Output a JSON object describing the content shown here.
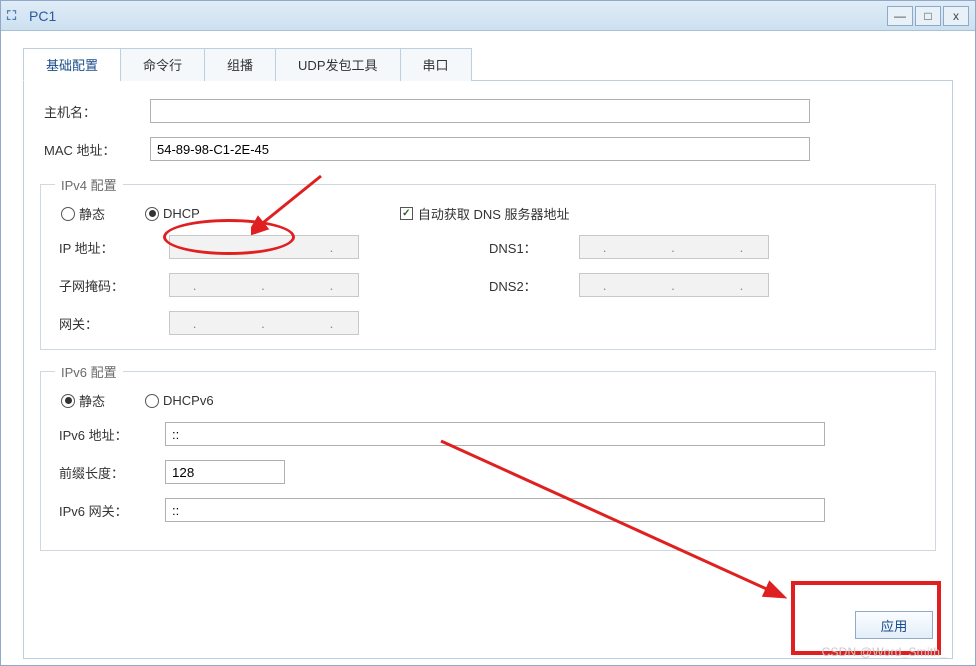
{
  "window": {
    "title": "PC1"
  },
  "winbtns": {
    "min": "—",
    "max": "□",
    "close": "x"
  },
  "tabs": [
    "基础配置",
    "命令行",
    "组播",
    "UDP发包工具",
    "串口"
  ],
  "basic": {
    "hostname_label": "主机名：",
    "hostname_value": "",
    "mac_label": "MAC 地址：",
    "mac_value": "54-89-98-C1-2E-45"
  },
  "ipv4": {
    "legend": "IPv4 配置",
    "static": "静态",
    "dhcp": "DHCP",
    "auto_dns": "自动获取 DNS 服务器地址",
    "ip_label": "IP 地址：",
    "mask_label": "子网掩码：",
    "gw_label": "网关：",
    "dns1_label": "DNS1：",
    "dns2_label": "DNS2：",
    "dots": ".           .           .",
    "ip": "",
    "mask": "",
    "gw": "",
    "dns1": "",
    "dns2": ""
  },
  "ipv6": {
    "legend": "IPv6 配置",
    "static": "静态",
    "dhcpv6": "DHCPv6",
    "addr_label": "IPv6 地址：",
    "addr": "::",
    "prefix_label": "前缀长度：",
    "prefix": "128",
    "gw_label": "IPv6 网关：",
    "gw": "::"
  },
  "apply": "应用",
  "watermark": "CSDN @Word_Smith_"
}
